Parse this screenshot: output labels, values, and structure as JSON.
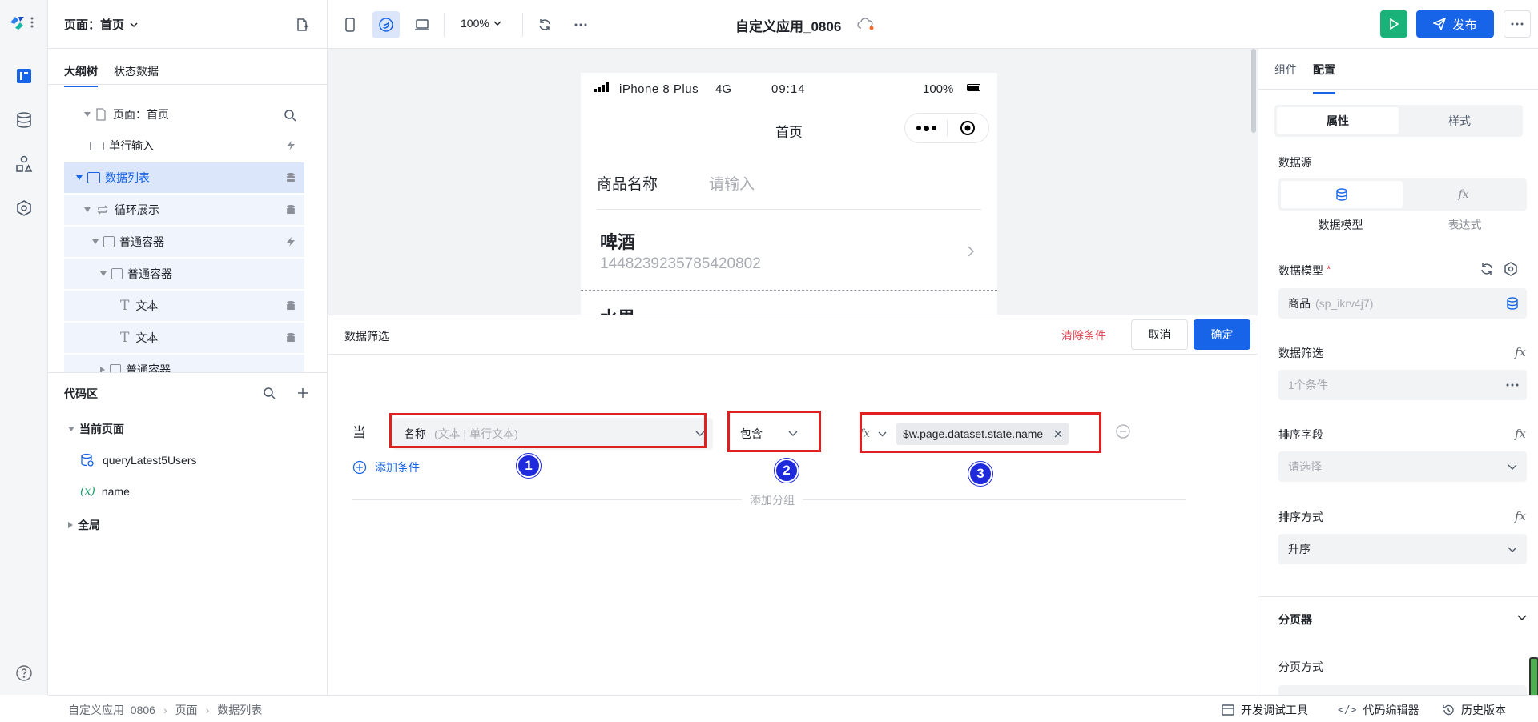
{
  "topbar": {
    "page_label": "页面：首页",
    "zoom": "100%",
    "app_title": "自定义应用_0806",
    "publish_label": "发布"
  },
  "outline": {
    "tab_active": "大纲树",
    "tab_other": "状态数据",
    "tree": [
      {
        "label": "页面：首页"
      },
      {
        "label": "单行输入"
      },
      {
        "label": "数据列表"
      },
      {
        "label": "循环展示"
      },
      {
        "label": "普通容器"
      },
      {
        "label": "普通容器"
      },
      {
        "label": "文本"
      },
      {
        "label": "文本"
      },
      {
        "label": "普通容器"
      }
    ]
  },
  "code": {
    "title": "代码区",
    "current_page": "当前页面",
    "items": [
      {
        "label": "queryLatest5Users"
      },
      {
        "label": "name",
        "prefix": "(x)"
      }
    ],
    "global": "全局"
  },
  "phone": {
    "carrier": "iPhone 8 Plus",
    "network": "4G",
    "time": "09:14",
    "battery": "100%",
    "nav_title": "首页",
    "field_label": "商品名称",
    "field_placeholder": "请输入",
    "item_title": "啤酒",
    "item_sub": "1448239235785420802",
    "item2_title": "水果"
  },
  "filter": {
    "title": "数据筛选",
    "clear": "清除条件",
    "cancel": "取消",
    "confirm": "确定",
    "when": "当",
    "field_name": "名称",
    "field_type": "(文本 | 单行文本)",
    "operator": "包含",
    "fx_label": "fx",
    "value_tag": "$w.page.dataset.state.name",
    "add_condition": "添加条件",
    "add_group": "添加分组",
    "badges": [
      "1",
      "2",
      "3"
    ]
  },
  "rpanel": {
    "tab_component": "组件",
    "tab_config": "配置",
    "seg_props": "属性",
    "seg_style": "样式",
    "datasource_label": "数据源",
    "ds_model": "数据模型",
    "ds_expr": "表达式",
    "model_label": "数据模型",
    "model_value": "商品",
    "model_id": "(sp_ikrv4j7)",
    "filter_label": "数据筛选",
    "filter_value": "1个条件",
    "sort_field_label": "排序字段",
    "sort_field_placeholder": "请选择",
    "sort_order_label": "排序方式",
    "sort_order_value": "升序",
    "pager_label": "分页器",
    "pager_mode_label": "分页方式"
  },
  "status": {
    "breadcrumb": [
      "自定义应用_0806",
      "页面",
      "数据列表"
    ],
    "dev_tools": "开发调试工具",
    "code_editor": "代码编辑器",
    "history": "历史版本"
  },
  "colors": {
    "accent": "#1764e8",
    "danger": "#e34d59",
    "highlight": "#e02020",
    "run": "#19b37a"
  }
}
